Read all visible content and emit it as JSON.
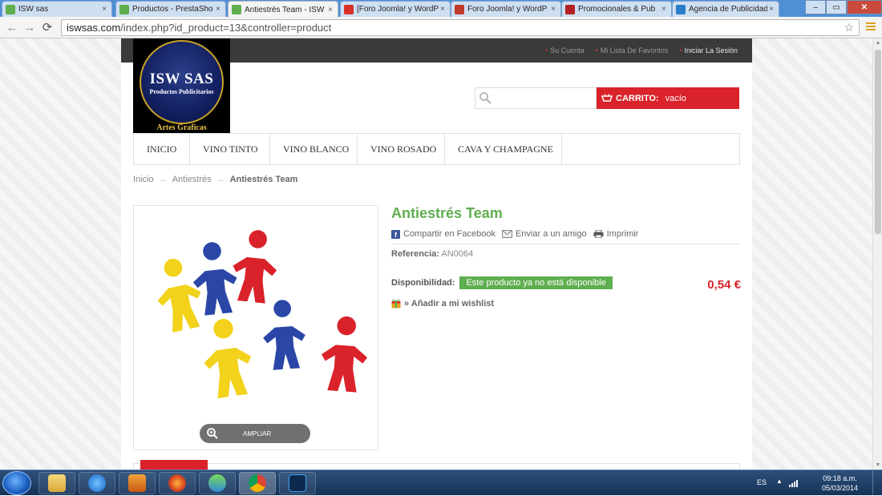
{
  "browser": {
    "tabs": [
      {
        "title": "ISW sas",
        "favicon_color": "#5fae4f"
      },
      {
        "title": "Productos - PrestaSho",
        "favicon_color": "#5fae4f"
      },
      {
        "title": "Antiestrés Team - ISW",
        "favicon_color": "#5fae4f",
        "active": true
      },
      {
        "title": "[Foro Joomla! y WordP",
        "favicon_color": "#d93025"
      },
      {
        "title": "Foro Joomla! y WordP",
        "favicon_color": "#c0392b"
      },
      {
        "title": "Promocionales & Pub",
        "favicon_color": "#b22222"
      },
      {
        "title": "Agencia de Publicidad",
        "favicon_color": "#2a7bc8"
      }
    ],
    "tab_close": "×",
    "url_host": "iswsas.com",
    "url_path": "/index.php?id_product=13&controller=product"
  },
  "header": {
    "top_links": [
      "Su Cuenta",
      "Mi Lista De Favoritos",
      "Iniciar La Sesión"
    ],
    "logo": {
      "main": "ISW SAS",
      "sub": "Productos Publicitarios",
      "bottom": "Artes Graficas"
    },
    "search_placeholder": "",
    "cart": {
      "label": "CARRITO:",
      "status": "vacío"
    }
  },
  "nav": [
    "INICIO",
    "VINO TINTO",
    "VINO BLANCO",
    "VINO ROSADO",
    "CAVA Y CHAMPAGNE"
  ],
  "breadcrumb": {
    "items": [
      "Inicio",
      "Antiestrés"
    ],
    "current": "Antiestrés Team",
    "separator": "→"
  },
  "product": {
    "title": "Antiestrés Team",
    "share": {
      "facebook": "Compartir en Facebook",
      "email": "Enviar a un amigo",
      "print": "Imprimir"
    },
    "reference_label": "Referencia:",
    "reference": "AN0064",
    "availability_label": "Disponibilidad:",
    "availability": "Este producto ya no está disponible",
    "price": "0,54 €",
    "wishlist": "» Añadir a mi wishlist",
    "zoom_label": "AMPLIAR",
    "figure_colors": [
      "#f2d21b",
      "#2a47a8",
      "#d9222a",
      "#f2d21b",
      "#2a47a8",
      "#d9222a"
    ]
  },
  "taskbar": {
    "lang": "ES",
    "time": "09:18 a.m.",
    "date": "05/03/2014"
  }
}
